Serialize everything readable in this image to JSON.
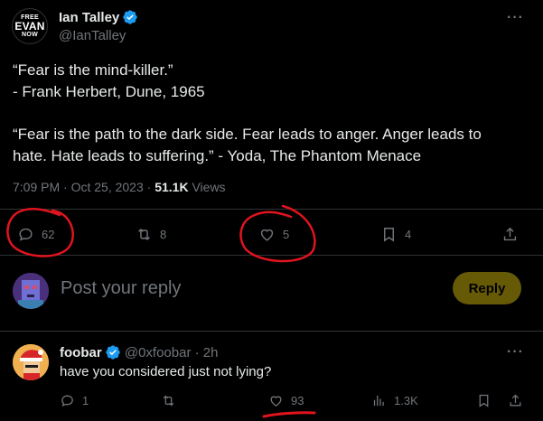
{
  "tweet": {
    "author": {
      "name": "Ian Talley",
      "handle": "@IanTalley",
      "avatar_text": [
        "FREE",
        "EVAN",
        "NOW"
      ]
    },
    "lines": [
      "“Fear is the mind-killer.”",
      "- Frank Herbert, Dune, 1965",
      "“Fear is the path to the dark side. Fear leads to anger. Anger leads to",
      "hate. Hate leads to suffering.” - Yoda, The Phantom Menace"
    ],
    "time": "7:09 PM",
    "date": "Oct 25, 2023",
    "views_count": "51.1K",
    "views_label": "Views",
    "actions": {
      "replies": "62",
      "retweets": "8",
      "likes": "5",
      "bookmarks": "4"
    },
    "more_label": "···"
  },
  "composer": {
    "placeholder": "Post your reply",
    "button": "Reply"
  },
  "reply": {
    "name": "foobar",
    "handle": "@0xfoobar",
    "separator": "·",
    "age": "2h",
    "text": "have you considered just not lying?",
    "actions": {
      "replies": "1",
      "retweets": "",
      "likes": "93",
      "views": "1.3K"
    },
    "more_label": "···"
  },
  "colors": {
    "background": "#000000",
    "text": "#e7e9ea",
    "muted": "#71767b",
    "verified": "#1d9bf0",
    "reply_button": "#786a09",
    "annotation": "#e0141e"
  }
}
